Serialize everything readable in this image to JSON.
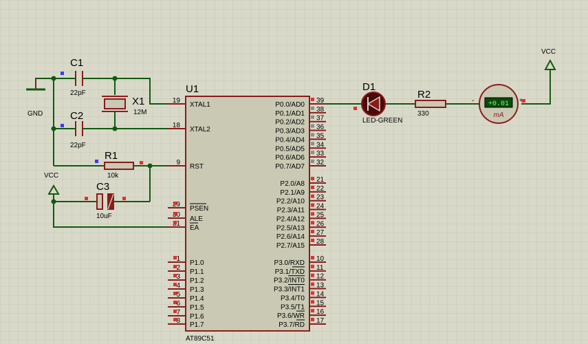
{
  "chip": {
    "ref": "U1",
    "name": "AT89C51",
    "left_pins": [
      {
        "num": "19",
        "label": "XTAL1"
      },
      {
        "num": "18",
        "label": "XTAL2"
      },
      {
        "num": "9",
        "label": "RST"
      },
      {
        "num": "29",
        "label": "PSEN",
        "bar": true
      },
      {
        "num": "30",
        "label": "ALE"
      },
      {
        "num": "31",
        "label": "EA",
        "bar": true
      },
      {
        "num": "1",
        "label": "P1.0"
      },
      {
        "num": "2",
        "label": "P1.1"
      },
      {
        "num": "3",
        "label": "P1.2"
      },
      {
        "num": "4",
        "label": "P1.3"
      },
      {
        "num": "5",
        "label": "P1.4"
      },
      {
        "num": "6",
        "label": "P1.5"
      },
      {
        "num": "7",
        "label": "P1.6"
      },
      {
        "num": "8",
        "label": "P1.7"
      }
    ],
    "right_pins": [
      {
        "num": "39",
        "label": "P0.0/AD0"
      },
      {
        "num": "38",
        "label": "P0.1/AD1"
      },
      {
        "num": "37",
        "label": "P0.2/AD2"
      },
      {
        "num": "36",
        "label": "P0.3/AD3"
      },
      {
        "num": "35",
        "label": "P0.4/AD4"
      },
      {
        "num": "34",
        "label": "P0.5/AD5"
      },
      {
        "num": "33",
        "label": "P0.6/AD6"
      },
      {
        "num": "32",
        "label": "P0.7/AD7"
      },
      {
        "num": "21",
        "label": "P2.0/A8"
      },
      {
        "num": "22",
        "label": "P2.1/A9"
      },
      {
        "num": "23",
        "label": "P2.2/A10"
      },
      {
        "num": "24",
        "label": "P2.3/A11"
      },
      {
        "num": "25",
        "label": "P2.4/A12"
      },
      {
        "num": "26",
        "label": "P2.5/A13"
      },
      {
        "num": "27",
        "label": "P2.6/A14"
      },
      {
        "num": "28",
        "label": "P2.7/A15"
      },
      {
        "num": "10",
        "label": "P3.0/RXD"
      },
      {
        "num": "11",
        "label": "P3.1/TXD",
        "bar_part": "TXD"
      },
      {
        "num": "12",
        "label": "P3.2/INT0",
        "bar_part": "INT0"
      },
      {
        "num": "13",
        "label": "P3.3/INT1",
        "bar_part": "INT1"
      },
      {
        "num": "14",
        "label": "P3.4/T0"
      },
      {
        "num": "15",
        "label": "P3.5/T1"
      },
      {
        "num": "16",
        "label": "P3.6/WR",
        "bar_part": "WR"
      },
      {
        "num": "17",
        "label": "P3.7/RD",
        "bar_part": "RD"
      }
    ]
  },
  "components": {
    "c1": {
      "ref": "C1",
      "value": "22pF"
    },
    "c2": {
      "ref": "C2",
      "value": "22pF"
    },
    "x1": {
      "ref": "X1",
      "value": "12M"
    },
    "r1": {
      "ref": "R1",
      "value": "10k"
    },
    "c3": {
      "ref": "C3",
      "value": "10uF"
    },
    "d1": {
      "ref": "D1",
      "value": "LED-GREEN"
    },
    "r2": {
      "ref": "R2",
      "value": "330"
    },
    "meter": {
      "reading": "+0.01",
      "unit": "mA",
      "minus": "-",
      "plus": "+"
    }
  },
  "power": {
    "gnd": "GND",
    "vcc_left": "VCC",
    "vcc_right": "VCC"
  },
  "colors": {
    "background": "#d9d9c9",
    "grid": "#c6c6b4",
    "wire": "#0f5a0f",
    "component": "#8b1a1a",
    "chip_fill": "#c9c9b4",
    "pin_marker_red": "#e03030",
    "pin_marker_gray": "#8c8c8c",
    "pin_marker_blue": "#3a3aff",
    "meter_display": "#0a4a0a",
    "meter_text": "#7dff7d"
  }
}
